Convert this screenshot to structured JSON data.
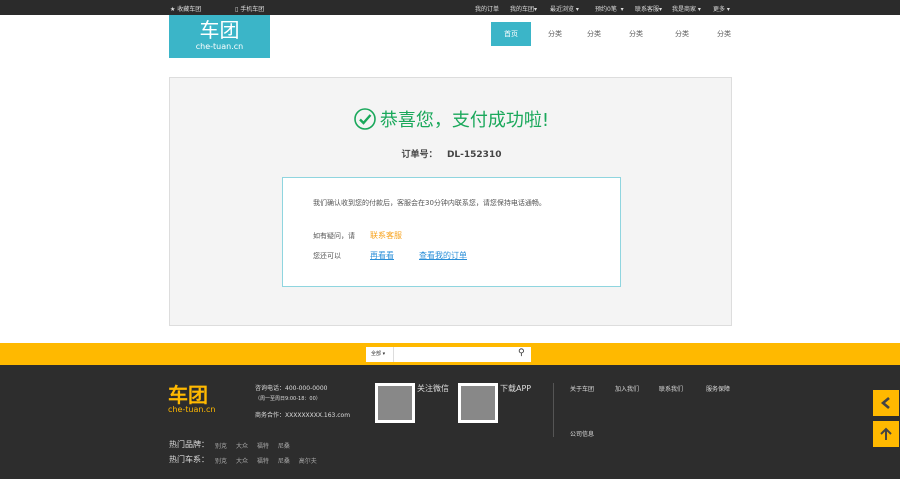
{
  "topbar": {
    "favorite": "收藏车团",
    "mobile": "手机车团",
    "links": [
      "我的订单",
      "我的车团",
      "最近浏览",
      "预约0笔",
      "联系客服",
      "我是商家",
      "更多"
    ]
  },
  "logo": {
    "name": "车团",
    "domain": "che-tuan.cn"
  },
  "nav": [
    "首页",
    "分类",
    "分类",
    "分类",
    "分类",
    "分类"
  ],
  "success": {
    "title": "恭喜您，支付成功啦!",
    "order_label": "订单号：",
    "order_no": "DL-152310",
    "message": "我们确认收到您的付款后，客服会在30分钟内联系您，请您保持电话通畅。",
    "question": "如有疑问，请",
    "contact": "联系客服",
    "also": "您还可以",
    "browse": "再看看",
    "my_orders": "查看我的订单"
  },
  "search": {
    "category": "全部",
    "placeholder": ""
  },
  "footer": {
    "logo": "车团",
    "domain": "che-tuan.cn",
    "phone": "咨询电话：400-000-0000",
    "hours": "（周一至周日9:00-18：00）",
    "biz": "商务合作：XXXXXXXXX.163.com",
    "wechat": "关注微信",
    "app": "下载APP",
    "links": [
      "关于车团",
      "加入我们",
      "联系我们",
      "服务保障",
      "公司信息"
    ],
    "brands_label": "热门品牌：",
    "brands": [
      "别克",
      "大众",
      "福特",
      "尼桑"
    ],
    "series_label": "热门车系：",
    "series": [
      "别克",
      "大众",
      "福特",
      "尼桑",
      "高尔夫"
    ]
  },
  "colors": {
    "accent": "#3bb5c8",
    "success": "#1aa85b",
    "yellow": "#ffb900"
  }
}
